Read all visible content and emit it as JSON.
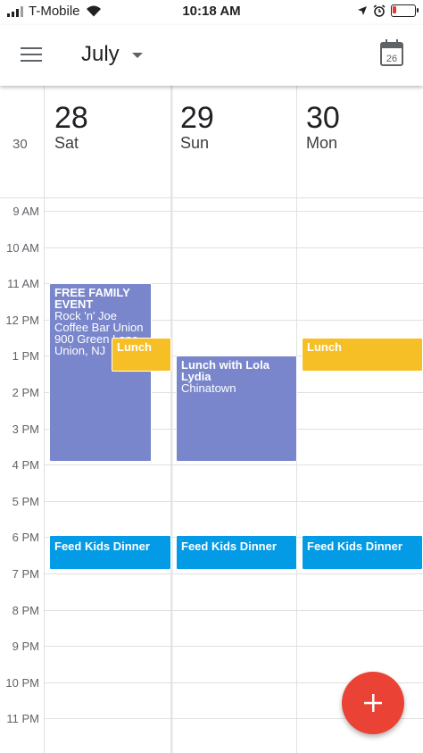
{
  "status_bar": {
    "carrier": "T-Mobile",
    "time": "10:18 AM",
    "battery_level": 0.2
  },
  "app_bar": {
    "month": "July",
    "today_date": "26"
  },
  "week_number": "30",
  "days": [
    {
      "num": "28",
      "name": "Sat"
    },
    {
      "num": "29",
      "name": "Sun"
    },
    {
      "num": "30",
      "name": "Mon"
    }
  ],
  "hours": [
    "9 AM",
    "10 AM",
    "11 AM",
    "12 PM",
    "1 PM",
    "2 PM",
    "3 PM",
    "4 PM",
    "5 PM",
    "6 PM",
    "7 PM",
    "8 PM",
    "9 PM",
    "10 PM",
    "11 PM"
  ],
  "events": {
    "family_event": {
      "title": "FREE FAMILY EVENT",
      "details": "Rock 'n' Joe Coffee Bar Union 900 Green Lane Union, NJ"
    },
    "lunch_sat": {
      "title": "Lunch"
    },
    "lunch_lola": {
      "title": "Lunch with Lola Lydia",
      "location": "Chinatown"
    },
    "lunch_mon": {
      "title": "Lunch"
    },
    "dinner_sat": {
      "title": "Feed Kids Dinner"
    },
    "dinner_sun": {
      "title": "Feed Kids Dinner"
    },
    "dinner_mon": {
      "title": "Feed Kids Dinner"
    }
  },
  "colors": {
    "purple": "#7986cb",
    "yellow": "#f6bf26",
    "blue": "#039be5",
    "fab": "#ea4335"
  },
  "icons": {
    "menu": "hamburger-icon",
    "dropdown": "caret-down-icon",
    "today": "calendar-today-icon",
    "add": "plus-icon"
  }
}
